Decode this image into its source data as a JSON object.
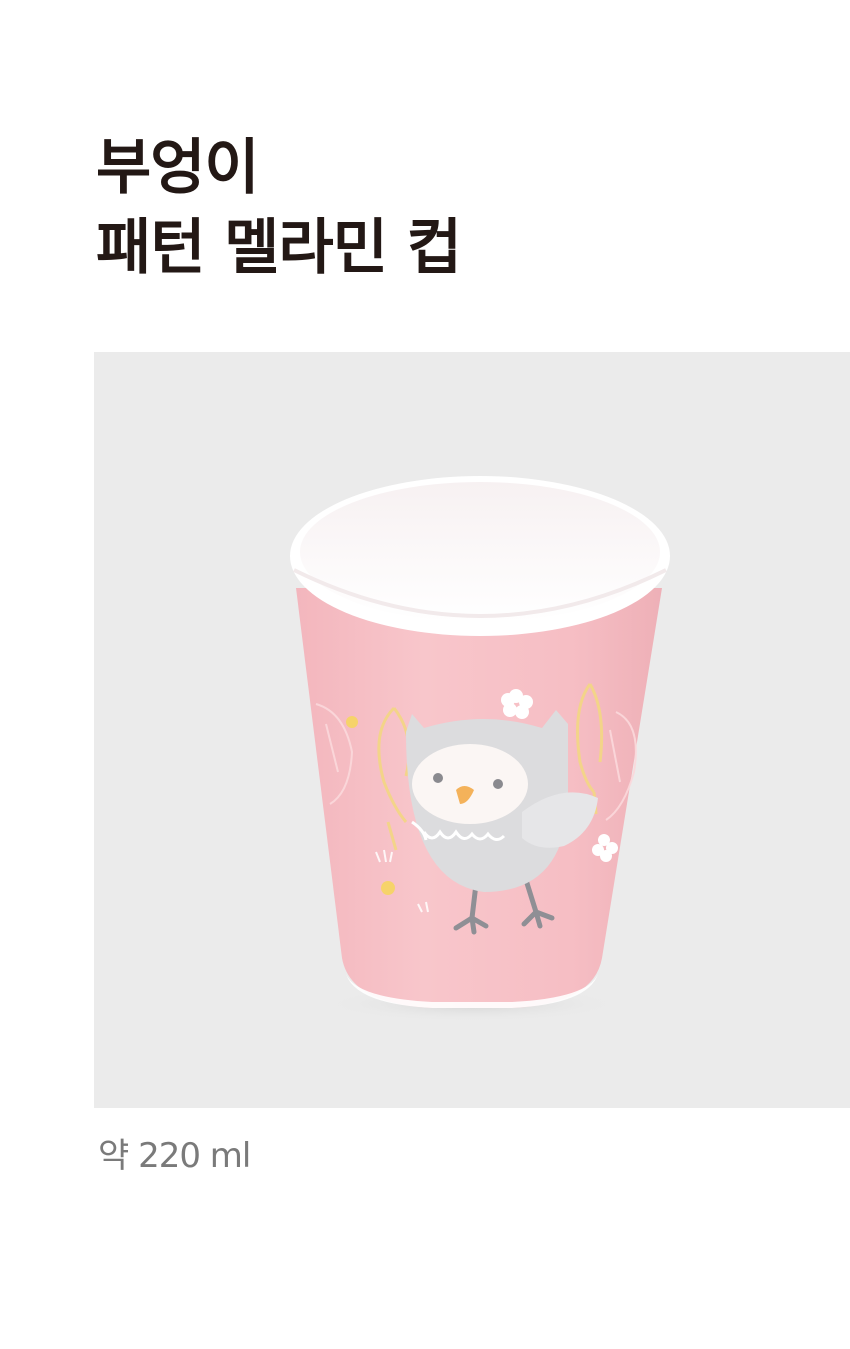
{
  "product": {
    "title_line1": "부엉이",
    "title_line2": "패턴 멜라민 컵",
    "capacity": "약 220 ml"
  },
  "image": {
    "subject": "owl-pattern-melamine-cup",
    "background_color": "#ebebeb",
    "cup_color": "#f7c3c8"
  }
}
